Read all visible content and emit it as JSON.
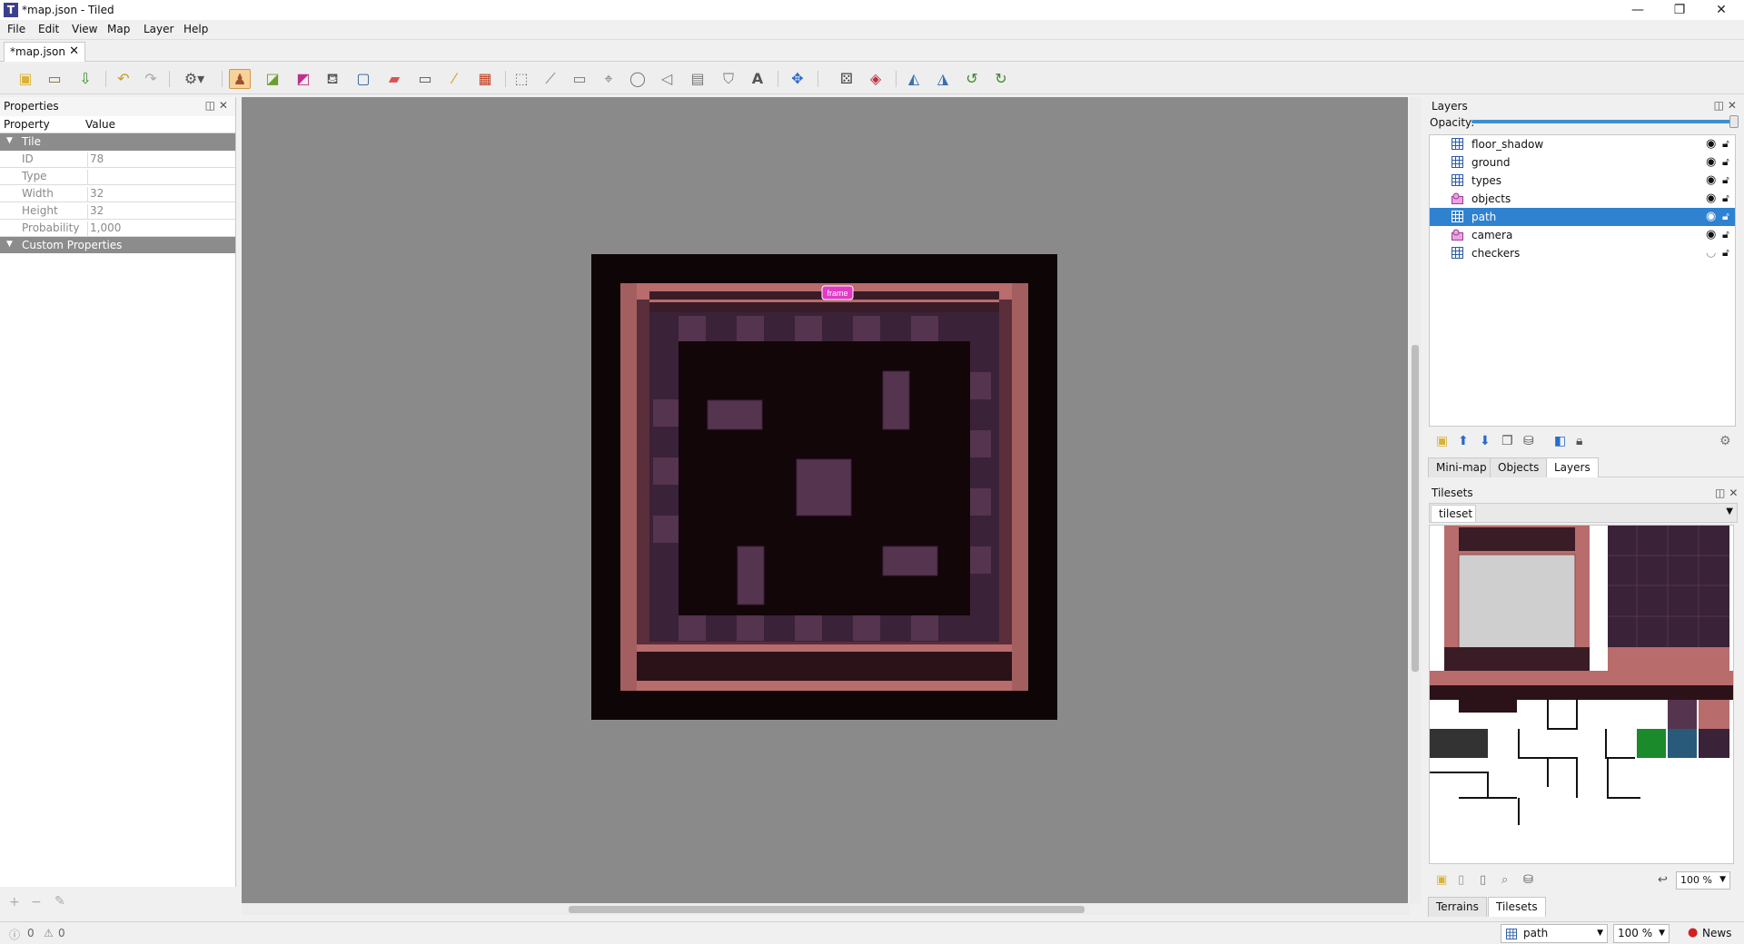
{
  "window": {
    "title": "*map.json - Tiled",
    "controls": {
      "minimize": "—",
      "maximize": "❐",
      "close": "✕"
    }
  },
  "menu": [
    "File",
    "Edit",
    "View",
    "Map",
    "Layer",
    "Help"
  ],
  "document_tab": {
    "label": "*map.json",
    "close": "✕"
  },
  "toolbar": {
    "icons": [
      "new-map-icon",
      "open-icon",
      "save-icon",
      "undo-icon",
      "redo-icon",
      "command-icon",
      "stamp-brush-icon",
      "terrain-brush-icon",
      "wang-brush-icon",
      "bucket-fill-icon",
      "shape-fill-icon",
      "eraser-icon",
      "rectangular-select-icon",
      "magic-wand-icon",
      "select-same-tile-icon",
      "select-objects-icon",
      "edit-polygons-icon",
      "insert-rectangle-icon",
      "insert-point-icon",
      "insert-ellipse-icon",
      "insert-polygon-icon",
      "insert-tile-icon",
      "insert-template-icon",
      "insert-text-icon",
      "move-icon",
      "random-mode-icon",
      "wang-fill-mode-icon",
      "flip-horizontal-icon",
      "flip-vertical-icon",
      "rotate-left-icon",
      "rotate-right-icon"
    ],
    "active": "stamp-brush-icon"
  },
  "properties": {
    "title": "Properties",
    "header": {
      "property": "Property",
      "value": "Value"
    },
    "group": "Tile",
    "rows": [
      {
        "key": "ID",
        "value": "78"
      },
      {
        "key": "Type",
        "value": ""
      },
      {
        "key": "Width",
        "value": "32"
      },
      {
        "key": "Height",
        "value": "32"
      },
      {
        "key": "Probability",
        "value": "1,000"
      }
    ],
    "custom_group": "Custom Properties"
  },
  "status": {
    "errors": "0",
    "warnings": "0"
  },
  "map": {
    "object_label": "frame",
    "colors": {
      "background": "#0e0507",
      "wall": "#b86c6c",
      "floor_dark": "#3a2238",
      "floor_light": "#55344f"
    }
  },
  "layers": {
    "title": "Layers",
    "opacity_label": "Opacity:",
    "items": [
      {
        "name": "floor_shadow",
        "kind": "tile",
        "visible": true,
        "selected": false
      },
      {
        "name": "ground",
        "kind": "tile",
        "visible": true,
        "selected": false
      },
      {
        "name": "types",
        "kind": "tile",
        "visible": true,
        "selected": false
      },
      {
        "name": "objects",
        "kind": "object",
        "visible": true,
        "selected": false
      },
      {
        "name": "path",
        "kind": "tile",
        "visible": true,
        "selected": true
      },
      {
        "name": "camera",
        "kind": "object",
        "visible": true,
        "selected": false
      },
      {
        "name": "checkers",
        "kind": "tile",
        "visible": false,
        "selected": false
      }
    ],
    "tabs": [
      "Mini-map",
      "Objects",
      "Layers"
    ],
    "active_tab": "Layers"
  },
  "tilesets": {
    "title": "Tilesets",
    "active_tileset": "tileset",
    "zoom": "100 %",
    "tabs": [
      "Terrains",
      "Tilesets"
    ],
    "active_tab": "Tilesets"
  },
  "statusbar": {
    "layer": "path",
    "zoom": "100 %",
    "news": "News"
  }
}
